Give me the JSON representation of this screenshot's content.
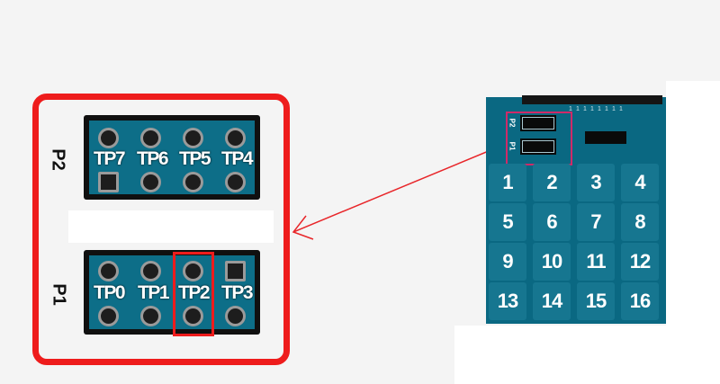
{
  "zoom": {
    "p2": {
      "label": "P2",
      "pins": [
        "TP7",
        "TP6",
        "TP5",
        "TP4"
      ]
    },
    "p1": {
      "label": "P1",
      "pins": [
        "TP0",
        "TP1",
        "TP2",
        "TP3"
      ]
    },
    "highlighted_pin": "TP2"
  },
  "board": {
    "header_labels": [
      "P2",
      "P1"
    ],
    "keys": [
      "1",
      "2",
      "3",
      "4",
      "5",
      "6",
      "7",
      "8",
      "9",
      "10",
      "11",
      "12",
      "13",
      "14",
      "15",
      "16"
    ],
    "pin_numbers": [
      "1",
      "1",
      "1",
      "1",
      "1",
      "1",
      "1",
      "1"
    ]
  },
  "colors": {
    "highlight": "#ee1c1c",
    "board": "#0a6882",
    "arrow": "#e8262a"
  }
}
